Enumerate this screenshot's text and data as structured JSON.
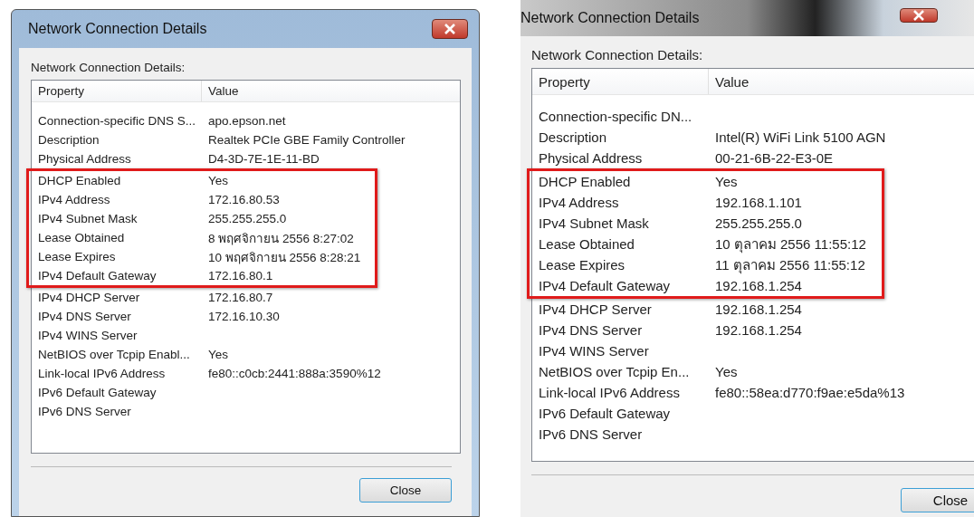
{
  "dialogs": [
    {
      "kind": "aero",
      "title": "Network Connection Details",
      "heading": "Network Connection Details:",
      "columns": [
        "Property",
        "Value"
      ],
      "rows": [
        {
          "property": "Connection-specific DNS S...",
          "value": "apo.epson.net",
          "highlighted": false
        },
        {
          "property": "Description",
          "value": "Realtek PCIe GBE Family Controller",
          "highlighted": false
        },
        {
          "property": "Physical Address",
          "value": "D4-3D-7E-1E-11-BD",
          "highlighted": false
        },
        {
          "property": "DHCP Enabled",
          "value": "Yes",
          "highlighted": true
        },
        {
          "property": "IPv4 Address",
          "value": "172.16.80.53",
          "highlighted": true
        },
        {
          "property": "IPv4 Subnet Mask",
          "value": "255.255.255.0",
          "highlighted": true
        },
        {
          "property": "Lease Obtained",
          "value": "8 พฤศจิกายน 2556 8:27:02",
          "highlighted": true
        },
        {
          "property": "Lease Expires",
          "value": "10 พฤศจิกายน 2556 8:28:21",
          "highlighted": true
        },
        {
          "property": "IPv4 Default Gateway",
          "value": "172.16.80.1",
          "highlighted": true
        },
        {
          "property": "IPv4 DHCP Server",
          "value": "172.16.80.7",
          "highlighted": false
        },
        {
          "property": "IPv4 DNS Server",
          "value": "172.16.10.30",
          "highlighted": false
        },
        {
          "property": "IPv4 WINS Server",
          "value": "",
          "highlighted": false
        },
        {
          "property": "NetBIOS over Tcpip Enabl...",
          "value": "Yes",
          "highlighted": false
        },
        {
          "property": "Link-local IPv6 Address",
          "value": "fe80::c0cb:2441:888a:3590%12",
          "highlighted": false
        },
        {
          "property": "IPv6 Default Gateway",
          "value": "",
          "highlighted": false
        },
        {
          "property": "IPv6 DNS Server",
          "value": "",
          "highlighted": false
        }
      ],
      "button": "Close"
    },
    {
      "kind": "dark",
      "title": "Network Connection Details",
      "heading": "Network Connection Details:",
      "columns": [
        "Property",
        "Value"
      ],
      "rows": [
        {
          "property": "Connection-specific DN...",
          "value": "",
          "highlighted": false
        },
        {
          "property": "Description",
          "value": "Intel(R) WiFi Link 5100 AGN",
          "highlighted": false
        },
        {
          "property": "Physical Address",
          "value": "00-21-6B-22-E3-0E",
          "highlighted": false
        },
        {
          "property": "DHCP Enabled",
          "value": "Yes",
          "highlighted": true
        },
        {
          "property": "IPv4 Address",
          "value": "192.168.1.101",
          "highlighted": true
        },
        {
          "property": "IPv4 Subnet Mask",
          "value": "255.255.255.0",
          "highlighted": true
        },
        {
          "property": "Lease Obtained",
          "value": "10 ตุลาคม 2556 11:55:12",
          "highlighted": true
        },
        {
          "property": "Lease Expires",
          "value": "11 ตุลาคม 2556 11:55:12",
          "highlighted": true
        },
        {
          "property": "IPv4 Default Gateway",
          "value": "192.168.1.254",
          "highlighted": true
        },
        {
          "property": "IPv4 DHCP Server",
          "value": "192.168.1.254",
          "highlighted": false
        },
        {
          "property": "IPv4 DNS Server",
          "value": "192.168.1.254",
          "highlighted": false
        },
        {
          "property": "IPv4 WINS Server",
          "value": "",
          "highlighted": false
        },
        {
          "property": "NetBIOS over Tcpip En...",
          "value": "Yes",
          "highlighted": false
        },
        {
          "property": "Link-local IPv6 Address",
          "value": "fe80::58ea:d770:f9ae:e5da%13",
          "highlighted": false
        },
        {
          "property": "IPv6 Default Gateway",
          "value": "",
          "highlighted": false
        },
        {
          "property": "IPv6 DNS Server",
          "value": "",
          "highlighted": false
        }
      ],
      "button": "Close"
    }
  ]
}
